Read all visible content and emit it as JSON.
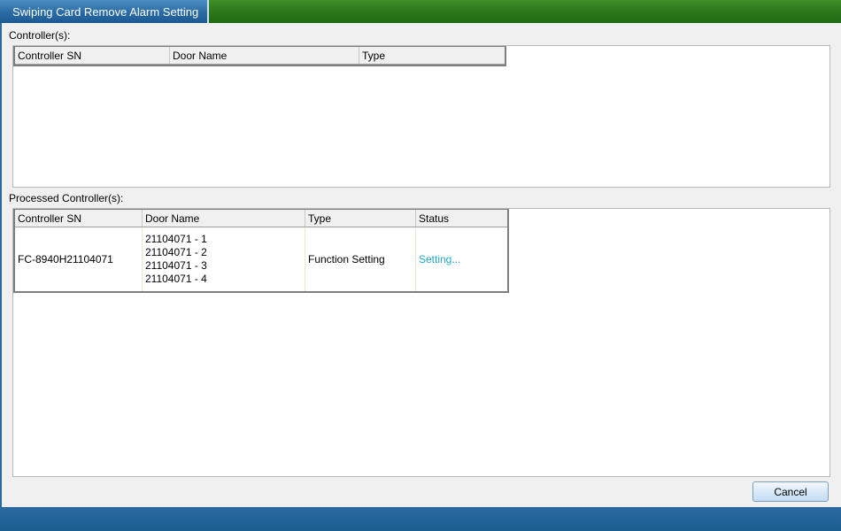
{
  "window": {
    "title": "Swiping Card Remove Alarm Setting"
  },
  "controllers": {
    "label": "Controller(s):",
    "columns": [
      "Controller SN",
      "Door Name",
      "Type"
    ],
    "rows": []
  },
  "processed": {
    "label": "Processed Controller(s):",
    "columns": [
      "Controller SN",
      "Door Name",
      "Type",
      "Status"
    ],
    "rows": [
      {
        "controller_sn": "FC-8940H21104071",
        "doors": [
          "21104071 - 1",
          "21104071 - 2",
          "21104071 - 3",
          "21104071 - 4"
        ],
        "type": "Function Setting",
        "status": "Setting..."
      }
    ]
  },
  "footer": {
    "cancel_label": "Cancel"
  },
  "colors": {
    "title_green": "#2f7a1e",
    "title_blue": "#2a6aa4",
    "status_text": "#22a6c4"
  }
}
